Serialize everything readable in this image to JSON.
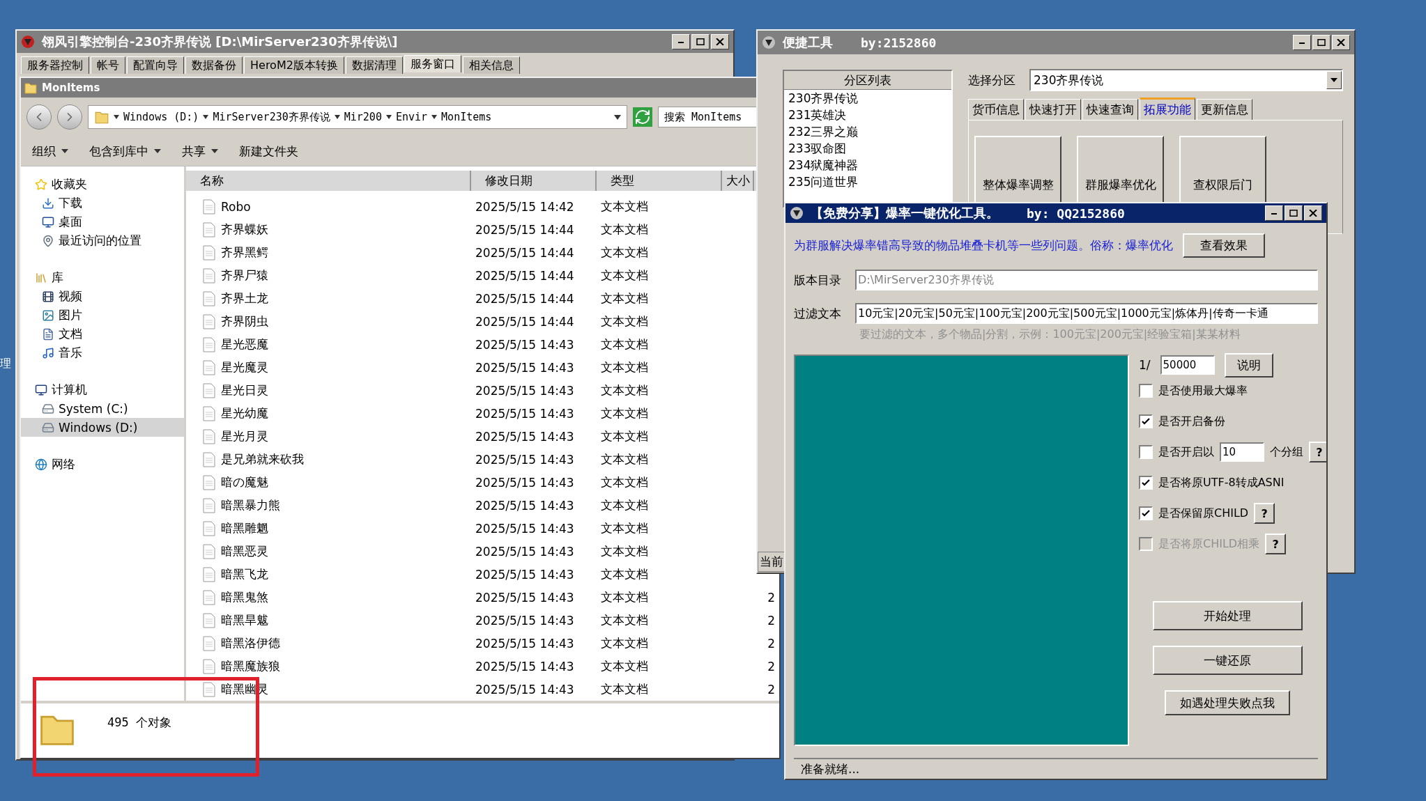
{
  "desktop": {
    "edge_text": "理"
  },
  "console": {
    "title": "翎风引擎控制台-230齐界传说 [D:\\MirServer230齐界传说\\]",
    "tabs": [
      {
        "label": "服务器控制",
        "selected": false
      },
      {
        "label": "帐号",
        "selected": false
      },
      {
        "label": "配置向导",
        "selected": false
      },
      {
        "label": "数据备份",
        "selected": false
      },
      {
        "label": "HeroM2版本转换",
        "selected": false
      },
      {
        "label": "数据清理",
        "selected": false
      },
      {
        "label": "服务窗口",
        "selected": true
      },
      {
        "label": "相关信息",
        "selected": false
      }
    ]
  },
  "explorer": {
    "title": "MonItems",
    "breadcrumbs": [
      "Windows (D:)",
      "MirServer230齐界传说",
      "Mir200",
      "Envir",
      "MonItems"
    ],
    "search": {
      "placeholder": "搜索 MonItems"
    },
    "toolbar": [
      {
        "label": "组织",
        "menu": true
      },
      {
        "label": "包含到库中",
        "menu": true
      },
      {
        "label": "共享",
        "menu": true
      },
      {
        "label": "新建文件夹",
        "menu": false
      }
    ],
    "nav": [
      {
        "label": "收藏夹",
        "selected": false,
        "children": [
          {
            "label": "下载",
            "selected": false
          },
          {
            "label": "桌面",
            "selected": false
          },
          {
            "label": "最近访问的位置",
            "selected": false
          }
        ]
      },
      {
        "label": "库",
        "selected": false,
        "children": [
          {
            "label": "视频",
            "selected": false
          },
          {
            "label": "图片",
            "selected": false
          },
          {
            "label": "文档",
            "selected": false
          },
          {
            "label": "音乐",
            "selected": false
          }
        ]
      },
      {
        "label": "计算机",
        "selected": false,
        "children": [
          {
            "label": "System (C:)",
            "selected": false
          },
          {
            "label": "Windows (D:)",
            "selected": true
          }
        ]
      },
      {
        "label": "网络",
        "selected": false
      }
    ],
    "columns": [
      "名称",
      "修改日期",
      "类型",
      "大小"
    ],
    "rows": [
      {
        "name": "Robo",
        "modified": "2025/5/15 14:42",
        "type": "文本文档"
      },
      {
        "name": "齐界蝶妖",
        "modified": "2025/5/15 14:44",
        "type": "文本文档"
      },
      {
        "name": "齐界黑鳄",
        "modified": "2025/5/15 14:44",
        "type": "文本文档"
      },
      {
        "name": "齐界尸猿",
        "modified": "2025/5/15 14:44",
        "type": "文本文档"
      },
      {
        "name": "齐界土龙",
        "modified": "2025/5/15 14:44",
        "type": "文本文档"
      },
      {
        "name": "齐界阴虫",
        "modified": "2025/5/15 14:44",
        "type": "文本文档"
      },
      {
        "name": "星光恶魔",
        "modified": "2025/5/15 14:43",
        "type": "文本文档"
      },
      {
        "name": "星光魔灵",
        "modified": "2025/5/15 14:43",
        "type": "文本文档"
      },
      {
        "name": "星光日灵",
        "modified": "2025/5/15 14:43",
        "type": "文本文档"
      },
      {
        "name": "星光幼魔",
        "modified": "2025/5/15 14:43",
        "type": "文本文档"
      },
      {
        "name": "星光月灵",
        "modified": "2025/5/15 14:43",
        "type": "文本文档"
      },
      {
        "name": "是兄弟就来砍我",
        "modified": "2025/5/15 14:43",
        "type": "文本文档"
      },
      {
        "name": "暗の魔魅",
        "modified": "2025/5/15 14:43",
        "type": "文本文档"
      },
      {
        "name": "暗黑暴力熊",
        "modified": "2025/5/15 14:43",
        "type": "文本文档"
      },
      {
        "name": "暗黑雕魍",
        "modified": "2025/5/15 14:43",
        "type": "文本文档"
      },
      {
        "name": "暗黑恶灵",
        "modified": "2025/5/15 14:43",
        "type": "文本文档"
      },
      {
        "name": "暗黑飞龙",
        "modified": "2025/5/15 14:43",
        "type": "文本文档"
      },
      {
        "name": "暗黑鬼煞",
        "modified": "2025/5/15 14:43",
        "type": "文本文档",
        "size": "2"
      },
      {
        "name": "暗黑旱魃",
        "modified": "2025/5/15 14:43",
        "type": "文本文档",
        "size": "2"
      },
      {
        "name": "暗黑洛伊德",
        "modified": "2025/5/15 14:43",
        "type": "文本文档",
        "size": "2"
      },
      {
        "name": "暗黑魔族狼",
        "modified": "2025/5/15 14:43",
        "type": "文本文档",
        "size": "2"
      },
      {
        "name": "暗黑幽灵",
        "modified": "2025/5/15 14:43",
        "type": "文本文档",
        "size": "2"
      }
    ],
    "status": "495 个对象"
  },
  "tool": {
    "title": "便捷工具",
    "author": "by:2152860",
    "list_header": "分区列表",
    "partitions": [
      "230齐界传说",
      "231英雄决",
      "232三界之巅",
      "233驭命图",
      "234狱魔神器",
      "235问道世界"
    ],
    "select_label": "选择分区",
    "select_value": "230齐界传说",
    "tabs": [
      {
        "label": "货币信息",
        "selected": false
      },
      {
        "label": "快速打开",
        "selected": false
      },
      {
        "label": "快速查询",
        "selected": false
      },
      {
        "label": "拓展功能",
        "selected": true
      },
      {
        "label": "更新信息",
        "selected": false
      }
    ],
    "buttons": [
      "整体爆率调整",
      "群服爆率优化",
      "查权限后门"
    ],
    "partial_label": "当前"
  },
  "dialog": {
    "title": "【免费分享】爆率一键优化工具。",
    "author": "by: QQ2152860",
    "description": "为群服解决爆率错高导致的物品堆叠卡机等一些列问题。俗称：爆率优化",
    "view_button": "查看效果",
    "dir_label": "版本目录",
    "dir_value": "D:\\MirServer230齐界传说",
    "filter_label": "过滤文本",
    "filter_value": "10元宝|20元宝|50元宝|100元宝|200元宝|500元宝|1000元宝|炼体丹|传奇一卡通",
    "filter_hint": "要过滤的文本，多个物品|分割，示例：100元宝|200元宝|经验宝箱|某某材料",
    "rate_prefix": "1/",
    "rate_value": "50000",
    "rate_button": "说明",
    "options": [
      {
        "kind": "plain",
        "label": "是否使用最大爆率",
        "checked": false,
        "disabled": false
      },
      {
        "kind": "plain",
        "label": "是否开启备份",
        "checked": true,
        "disabled": false
      },
      {
        "kind": "count",
        "label": "是否开启以",
        "value": "10",
        "suffix": "个分组",
        "help": "?",
        "checked": false,
        "disabled": false
      },
      {
        "kind": "plain",
        "label": "是否将原UTF-8转成ASNI",
        "checked": true,
        "disabled": false
      },
      {
        "kind": "help",
        "label": "是否保留原CHILD",
        "help": "?",
        "checked": true,
        "disabled": false
      },
      {
        "kind": "help",
        "label": "是否将原CHILD相乘",
        "help": "?",
        "checked": false,
        "disabled": true
      }
    ],
    "actions": [
      "开始处理",
      "一键还原",
      "如遇处理失败点我"
    ],
    "status": "准备就绪..."
  }
}
